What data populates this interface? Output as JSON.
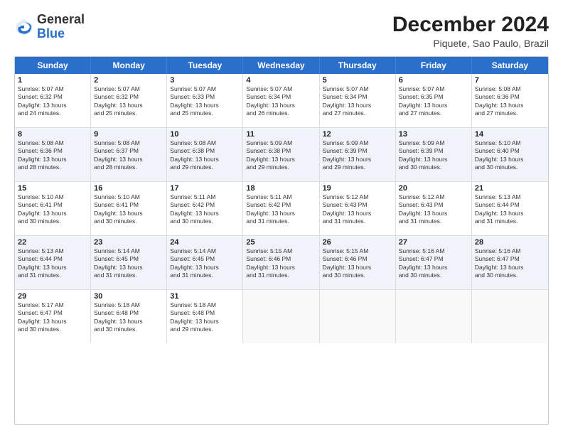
{
  "logo": {
    "general": "General",
    "blue": "Blue"
  },
  "title": "December 2024",
  "subtitle": "Piquete, Sao Paulo, Brazil",
  "headers": [
    "Sunday",
    "Monday",
    "Tuesday",
    "Wednesday",
    "Thursday",
    "Friday",
    "Saturday"
  ],
  "weeks": [
    [
      {
        "day": "1",
        "info": "Sunrise: 5:07 AM\nSunset: 6:32 PM\nDaylight: 13 hours\nand 24 minutes."
      },
      {
        "day": "2",
        "info": "Sunrise: 5:07 AM\nSunset: 6:32 PM\nDaylight: 13 hours\nand 25 minutes."
      },
      {
        "day": "3",
        "info": "Sunrise: 5:07 AM\nSunset: 6:33 PM\nDaylight: 13 hours\nand 25 minutes."
      },
      {
        "day": "4",
        "info": "Sunrise: 5:07 AM\nSunset: 6:34 PM\nDaylight: 13 hours\nand 26 minutes."
      },
      {
        "day": "5",
        "info": "Sunrise: 5:07 AM\nSunset: 6:34 PM\nDaylight: 13 hours\nand 27 minutes."
      },
      {
        "day": "6",
        "info": "Sunrise: 5:07 AM\nSunset: 6:35 PM\nDaylight: 13 hours\nand 27 minutes."
      },
      {
        "day": "7",
        "info": "Sunrise: 5:08 AM\nSunset: 6:36 PM\nDaylight: 13 hours\nand 27 minutes."
      }
    ],
    [
      {
        "day": "8",
        "info": "Sunrise: 5:08 AM\nSunset: 6:36 PM\nDaylight: 13 hours\nand 28 minutes."
      },
      {
        "day": "9",
        "info": "Sunrise: 5:08 AM\nSunset: 6:37 PM\nDaylight: 13 hours\nand 28 minutes."
      },
      {
        "day": "10",
        "info": "Sunrise: 5:08 AM\nSunset: 6:38 PM\nDaylight: 13 hours\nand 29 minutes."
      },
      {
        "day": "11",
        "info": "Sunrise: 5:09 AM\nSunset: 6:38 PM\nDaylight: 13 hours\nand 29 minutes."
      },
      {
        "day": "12",
        "info": "Sunrise: 5:09 AM\nSunset: 6:39 PM\nDaylight: 13 hours\nand 29 minutes."
      },
      {
        "day": "13",
        "info": "Sunrise: 5:09 AM\nSunset: 6:39 PM\nDaylight: 13 hours\nand 30 minutes."
      },
      {
        "day": "14",
        "info": "Sunrise: 5:10 AM\nSunset: 6:40 PM\nDaylight: 13 hours\nand 30 minutes."
      }
    ],
    [
      {
        "day": "15",
        "info": "Sunrise: 5:10 AM\nSunset: 6:41 PM\nDaylight: 13 hours\nand 30 minutes."
      },
      {
        "day": "16",
        "info": "Sunrise: 5:10 AM\nSunset: 6:41 PM\nDaylight: 13 hours\nand 30 minutes."
      },
      {
        "day": "17",
        "info": "Sunrise: 5:11 AM\nSunset: 6:42 PM\nDaylight: 13 hours\nand 30 minutes."
      },
      {
        "day": "18",
        "info": "Sunrise: 5:11 AM\nSunset: 6:42 PM\nDaylight: 13 hours\nand 31 minutes."
      },
      {
        "day": "19",
        "info": "Sunrise: 5:12 AM\nSunset: 6:43 PM\nDaylight: 13 hours\nand 31 minutes."
      },
      {
        "day": "20",
        "info": "Sunrise: 5:12 AM\nSunset: 6:43 PM\nDaylight: 13 hours\nand 31 minutes."
      },
      {
        "day": "21",
        "info": "Sunrise: 5:13 AM\nSunset: 6:44 PM\nDaylight: 13 hours\nand 31 minutes."
      }
    ],
    [
      {
        "day": "22",
        "info": "Sunrise: 5:13 AM\nSunset: 6:44 PM\nDaylight: 13 hours\nand 31 minutes."
      },
      {
        "day": "23",
        "info": "Sunrise: 5:14 AM\nSunset: 6:45 PM\nDaylight: 13 hours\nand 31 minutes."
      },
      {
        "day": "24",
        "info": "Sunrise: 5:14 AM\nSunset: 6:45 PM\nDaylight: 13 hours\nand 31 minutes."
      },
      {
        "day": "25",
        "info": "Sunrise: 5:15 AM\nSunset: 6:46 PM\nDaylight: 13 hours\nand 31 minutes."
      },
      {
        "day": "26",
        "info": "Sunrise: 5:15 AM\nSunset: 6:46 PM\nDaylight: 13 hours\nand 30 minutes."
      },
      {
        "day": "27",
        "info": "Sunrise: 5:16 AM\nSunset: 6:47 PM\nDaylight: 13 hours\nand 30 minutes."
      },
      {
        "day": "28",
        "info": "Sunrise: 5:16 AM\nSunset: 6:47 PM\nDaylight: 13 hours\nand 30 minutes."
      }
    ],
    [
      {
        "day": "29",
        "info": "Sunrise: 5:17 AM\nSunset: 6:47 PM\nDaylight: 13 hours\nand 30 minutes."
      },
      {
        "day": "30",
        "info": "Sunrise: 5:18 AM\nSunset: 6:48 PM\nDaylight: 13 hours\nand 30 minutes."
      },
      {
        "day": "31",
        "info": "Sunrise: 5:18 AM\nSunset: 6:48 PM\nDaylight: 13 hours\nand 29 minutes."
      },
      {
        "day": "",
        "info": ""
      },
      {
        "day": "",
        "info": ""
      },
      {
        "day": "",
        "info": ""
      },
      {
        "day": "",
        "info": ""
      }
    ]
  ]
}
